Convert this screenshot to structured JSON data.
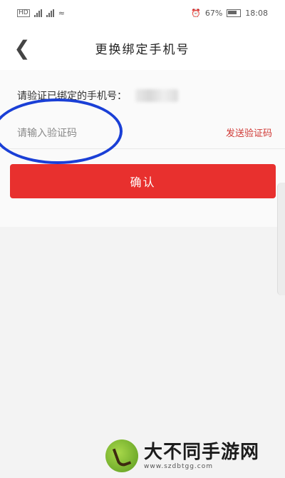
{
  "status_bar": {
    "battery_text": "67%",
    "time": "18:08"
  },
  "header": {
    "title": "更换绑定手机号",
    "back_icon": "chevron-left-icon"
  },
  "form": {
    "bound_phone_label": "请验证已绑定的手机号：",
    "code_placeholder": "请输入验证码",
    "send_code_label": "发送验证码",
    "confirm_label": "确认"
  },
  "watermark": {
    "name": "大不同手游网",
    "url": "www.szdbtgg.com"
  },
  "colors": {
    "accent": "#e8302e",
    "send_code": "#d03a36",
    "highlight": "#1a3fd6"
  }
}
